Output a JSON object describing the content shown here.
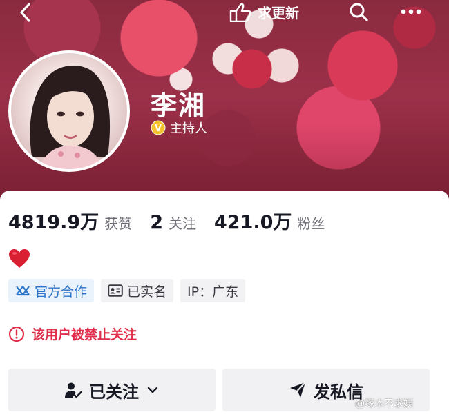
{
  "header": {
    "back_icon": "back-chevron-icon",
    "wish_icon": "thumb-point-icon",
    "wish_label": "求更新",
    "search_icon": "search-icon",
    "more_icon": "more-dots-icon"
  },
  "profile": {
    "name": "李湘",
    "verify_badge": "V",
    "verify_label": "主持人"
  },
  "stats": [
    {
      "value": "4819.9万",
      "label": "获赞"
    },
    {
      "value": "2",
      "label": "关注"
    },
    {
      "value": "421.0万",
      "label": "粉丝"
    }
  ],
  "bio": {
    "emoji": "heart-icon"
  },
  "tags": [
    {
      "label": "官方合作",
      "icon": "cooperation-icon"
    },
    {
      "label": "已实名",
      "icon": "id-card-icon"
    },
    {
      "label": "IP：广东",
      "icon": ""
    }
  ],
  "notice": {
    "text": "该用户被禁止关注",
    "icon": "alert-circle-icon"
  },
  "actions": {
    "follow_label": "已关注",
    "follow_icon": "user-check-icon",
    "message_label": "发私信",
    "message_icon": "send-icon"
  },
  "watermark": "@缘木不求娱",
  "colors": {
    "accent_red": "#e02e4b",
    "coop_blue": "#2c75c9",
    "button_bg": "#f1f1f3"
  }
}
